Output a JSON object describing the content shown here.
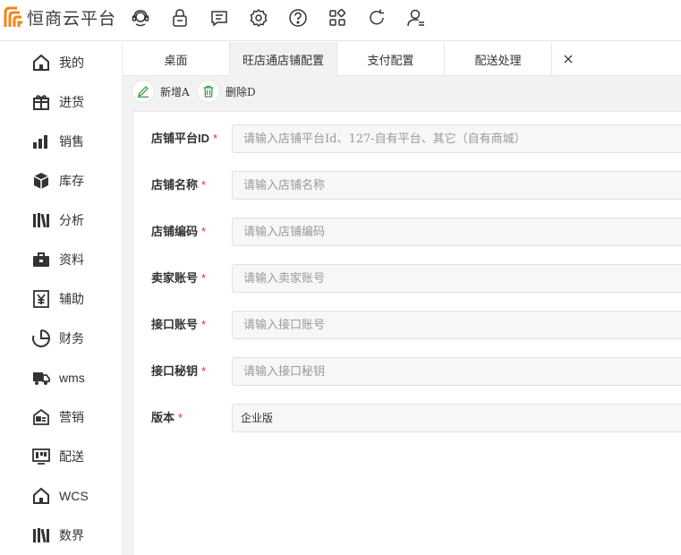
{
  "app": {
    "logo_text": "恒商云平台",
    "brand_color": "#f08519",
    "accent_color": "#3a9e4a"
  },
  "top_icons": [
    "support-icon",
    "lock-icon",
    "message-icon",
    "settings-icon",
    "help-icon",
    "apps-icon",
    "refresh-icon",
    "user-icon"
  ],
  "sidebar": {
    "items": [
      {
        "label": "我的",
        "icon": "home-icon"
      },
      {
        "label": "进货",
        "icon": "gift-box-icon"
      },
      {
        "label": "销售",
        "icon": "bar-chart-icon"
      },
      {
        "label": "库存",
        "icon": "cube-icon"
      },
      {
        "label": "分析",
        "icon": "books-icon"
      },
      {
        "label": "资料",
        "icon": "briefcase-icon"
      },
      {
        "label": "辅助",
        "icon": "yen-doc-icon"
      },
      {
        "label": "财务",
        "icon": "pie-icon"
      },
      {
        "label": "wms",
        "icon": "truck-icon"
      },
      {
        "label": "营销",
        "icon": "id-card-icon"
      },
      {
        "label": "配送",
        "icon": "monitor-icon"
      },
      {
        "label": "WCS",
        "icon": "home-icon"
      },
      {
        "label": "数界",
        "icon": "books-icon"
      }
    ]
  },
  "tabs": [
    {
      "label": "桌面"
    },
    {
      "label": "旺店通店铺配置",
      "active": true
    },
    {
      "label": "支付配置"
    },
    {
      "label": "配送处理"
    }
  ],
  "toolbar": {
    "add_label": "新增A",
    "delete_label": "删除D"
  },
  "form": {
    "fields": [
      {
        "label": "店铺平台ID",
        "placeholder": "请输入店铺平台Id、127-自有平台、其它（自有商城）"
      },
      {
        "label": "店铺名称",
        "placeholder": "请输入店铺名称"
      },
      {
        "label": "店铺编码",
        "placeholder": "请输入店铺编码"
      },
      {
        "label": "卖家账号",
        "placeholder": "请输入卖家账号"
      },
      {
        "label": "接口账号",
        "placeholder": "请输入接口账号"
      },
      {
        "label": "接口秘钥",
        "placeholder": "请输入接口秘钥"
      }
    ],
    "version": {
      "label": "版本",
      "value": "企业版"
    },
    "required_mark": "*"
  }
}
